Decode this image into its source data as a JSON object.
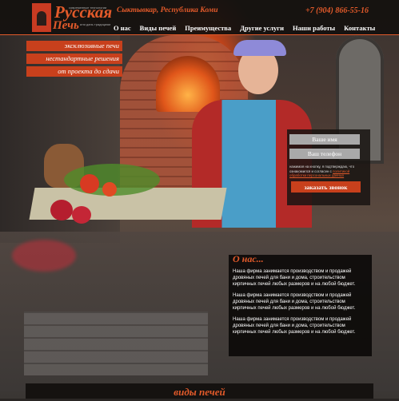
{
  "logo": {
    "title_line1": "Русская",
    "title_line2": "Печь",
    "tagline1": "современные технологии",
    "tagline2": "или дань традициям"
  },
  "header": {
    "city": "Сыктывкар, Республика Коми",
    "phone": "+7 (904) 866-55-16"
  },
  "nav": {
    "items": [
      "О нас",
      "Виды печей",
      "Преимущества",
      "Другие услуги",
      "Наши работы",
      "Контакты"
    ]
  },
  "hero": {
    "tags": [
      "эксклюзивные печи",
      "нестандартные решения",
      "от проекта до сдачи"
    ]
  },
  "form": {
    "name_placeholder": "Ваше имя",
    "phone_placeholder": "Ваш телефон",
    "agree_text": "нажимая на кнопку, я подтверждаю, что ознакомился и согласен с",
    "agree_link": "политикой обработки персональных данных",
    "submit_label": "заказать звонок"
  },
  "about": {
    "heading": "О нас...",
    "paragraphs": [
      "Наша фирма занимается производством и продажей дровяных печей для бани и дома, строительством кирпичных печей любых размеров и на любой бюджет.",
      "Наша фирма занимается производством и продажей дровяных печей для бани и дома, строительством кирпичных печей любых размеров и на любой бюджет.",
      "Наша фирма занимается производством и продажей дровяных печей для бани и дома, строительством кирпичных печей любых размеров и на любой бюджет."
    ]
  },
  "section_next": {
    "heading": "виды печей"
  },
  "colors": {
    "accent": "#e25a2a",
    "button": "#c8401c",
    "header_bg": "#14100e"
  }
}
